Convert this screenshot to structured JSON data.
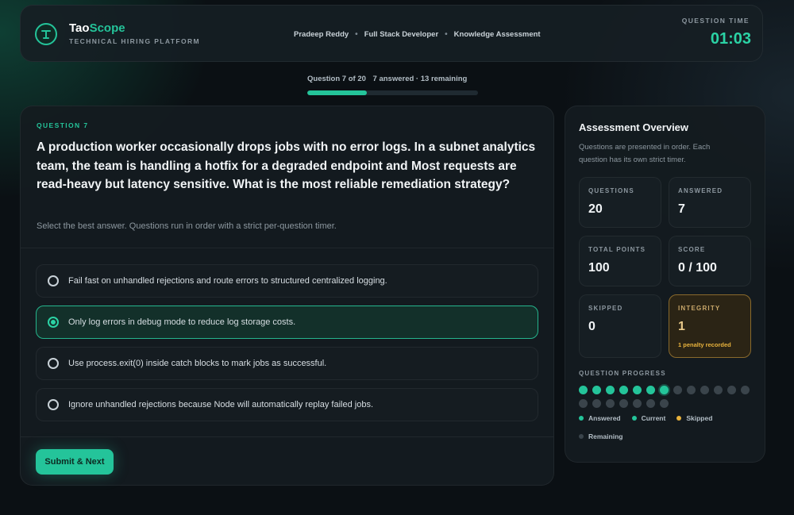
{
  "brand": {
    "name_main": "Tao",
    "name_accent": "Scope",
    "subtitle": "TECHNICAL HIRING PLATFORM"
  },
  "candidate": {
    "name": "Pradeep Reddy",
    "role": "Full Stack Developer",
    "assessment": "Knowledge Assessment"
  },
  "timer": {
    "label": "QUESTION TIME",
    "value": "01:03"
  },
  "progress": {
    "position": "Question 7 of 20",
    "summary": "7 answered · 13 remaining",
    "fraction": 0.35
  },
  "question": {
    "label": "QUESTION 7",
    "text": "A production worker occasionally drops jobs with no error logs. In a subnet analytics team, the team is handling a hotfix for a degraded endpoint and Most requests are read-heavy but latency sensitive. What is the most reliable remediation strategy?",
    "hint": "Select the best answer. Questions run in order with a strict per-question timer.",
    "options": [
      {
        "text": "Fail fast on unhandled rejections and route errors to structured centralized logging.",
        "selected": false
      },
      {
        "text": "Only log errors in debug mode to reduce log storage costs.",
        "selected": true
      },
      {
        "text": "Use process.exit(0) inside catch blocks to mark jobs as successful.",
        "selected": false
      },
      {
        "text": "Ignore unhandled rejections because Node will automatically replay failed jobs.",
        "selected": false
      }
    ],
    "submit_label": "Submit & Next"
  },
  "overview": {
    "title": "Assessment Overview",
    "description": "Questions are presented in order. Each question has its own strict timer.",
    "stats": {
      "questions": {
        "label": "QUESTIONS",
        "value": "20"
      },
      "answered": {
        "label": "ANSWERED",
        "value": "7"
      },
      "total_points": {
        "label": "TOTAL POINTS",
        "value": "100"
      },
      "score": {
        "label": "SCORE",
        "value": "0 / 100"
      },
      "skipped": {
        "label": "SKIPPED",
        "value": "0"
      },
      "integrity": {
        "label": "INTEGRITY",
        "value": "1",
        "note": "1 penalty recorded"
      }
    },
    "progress_label": "QUESTION PROGRESS",
    "progress_states": [
      "answered",
      "answered",
      "answered",
      "answered",
      "answered",
      "answered",
      "current",
      "remaining",
      "remaining",
      "remaining",
      "remaining",
      "remaining",
      "remaining",
      "remaining",
      "remaining",
      "remaining",
      "remaining",
      "remaining",
      "remaining",
      "remaining"
    ],
    "legend": {
      "answered": "Answered",
      "current": "Current",
      "skipped": "Skipped",
      "remaining": "Remaining"
    }
  },
  "colors": {
    "accent": "#24c49a",
    "timer": "#2bd3a5",
    "warning": "#e8b23c",
    "remaining": "#3a444b"
  }
}
